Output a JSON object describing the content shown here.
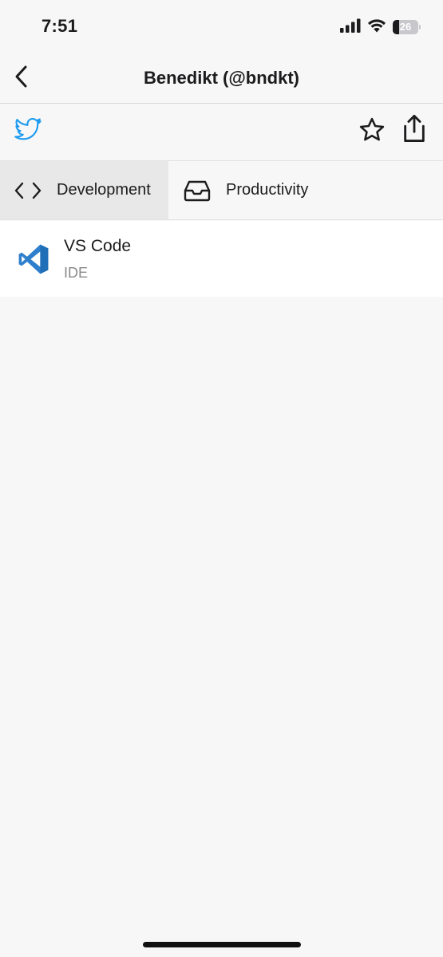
{
  "status_bar": {
    "time": "7:51",
    "battery_level": "26",
    "battery_fraction": 0.26
  },
  "nav": {
    "title": "Benedikt (@bndkt)",
    "back_icon": "chevron-left-icon"
  },
  "toolbar": {
    "twitter_icon": "twitter-bird-icon",
    "favorite_icon": "star-outline-icon",
    "share_icon": "share-icon"
  },
  "tabs": [
    {
      "label": "Development",
      "icon": "code-brackets-icon",
      "selected": true
    },
    {
      "label": "Productivity",
      "icon": "inbox-tray-icon",
      "selected": false
    }
  ],
  "items": [
    {
      "title": "VS Code",
      "subtitle": "IDE",
      "icon": "vscode-logo-icon"
    }
  ],
  "colors": {
    "background": "#f7f7f7",
    "selected_tab": "#e8e8e8",
    "twitter_blue": "#1d9bf0",
    "vscode_blue": "#2f80cc",
    "secondary_text": "#8a8a8e"
  }
}
